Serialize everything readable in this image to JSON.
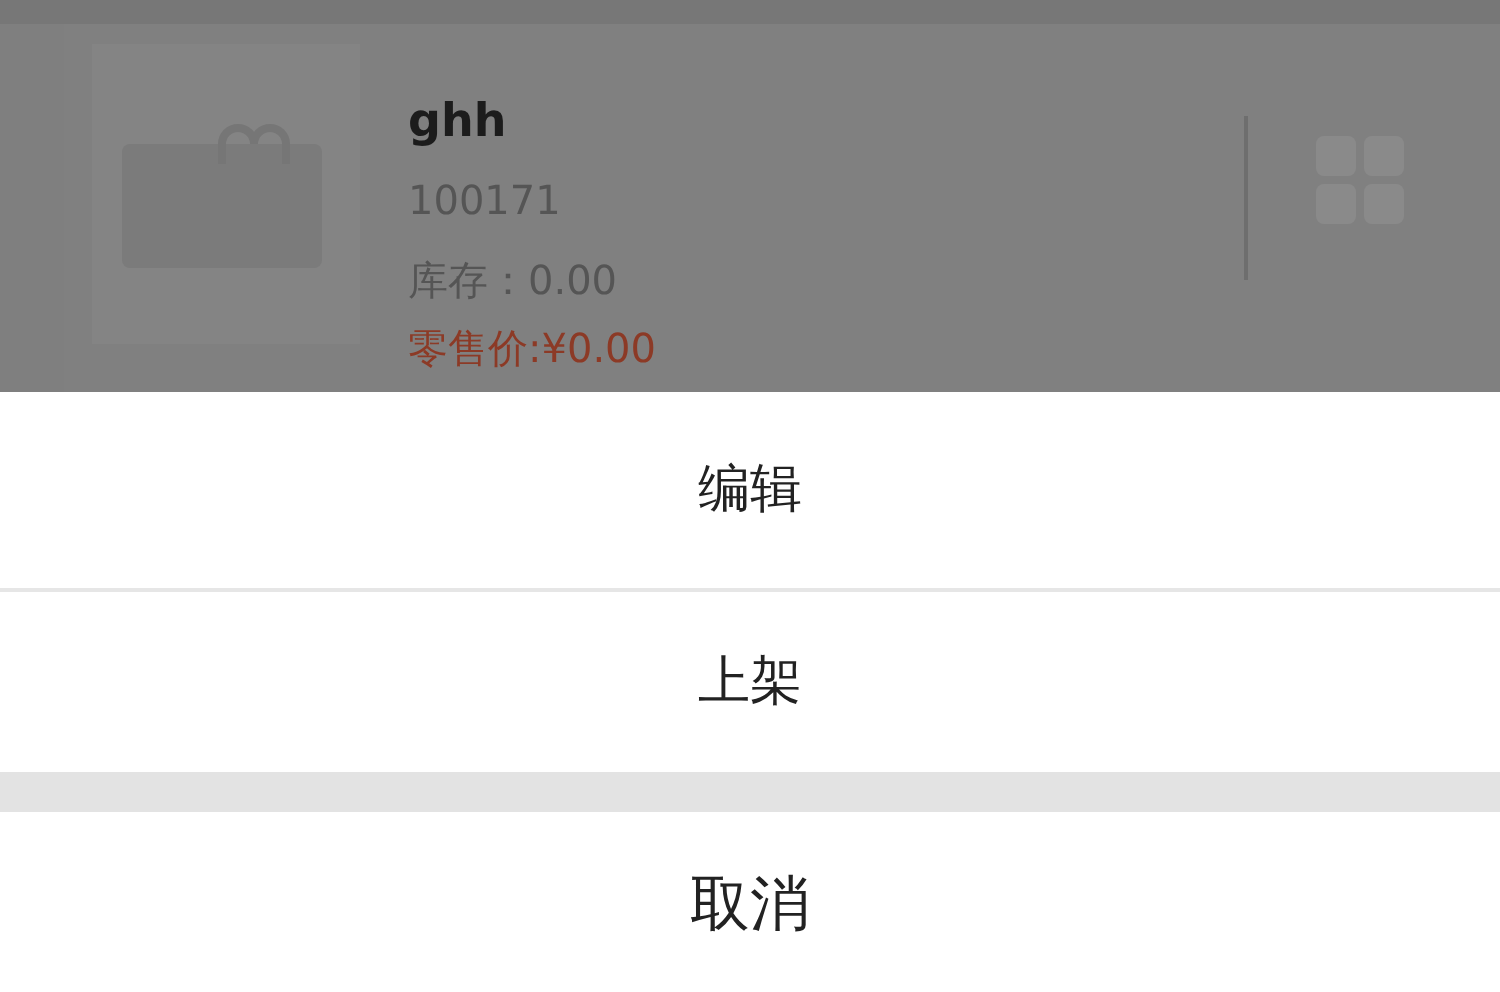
{
  "product": {
    "name": "ghh",
    "code": "100171",
    "stock": "库存：0.00",
    "price": "零售价:¥0.00"
  },
  "actions": [
    {
      "label": "编辑"
    },
    {
      "label": "上架"
    }
  ],
  "cancel": "取消"
}
